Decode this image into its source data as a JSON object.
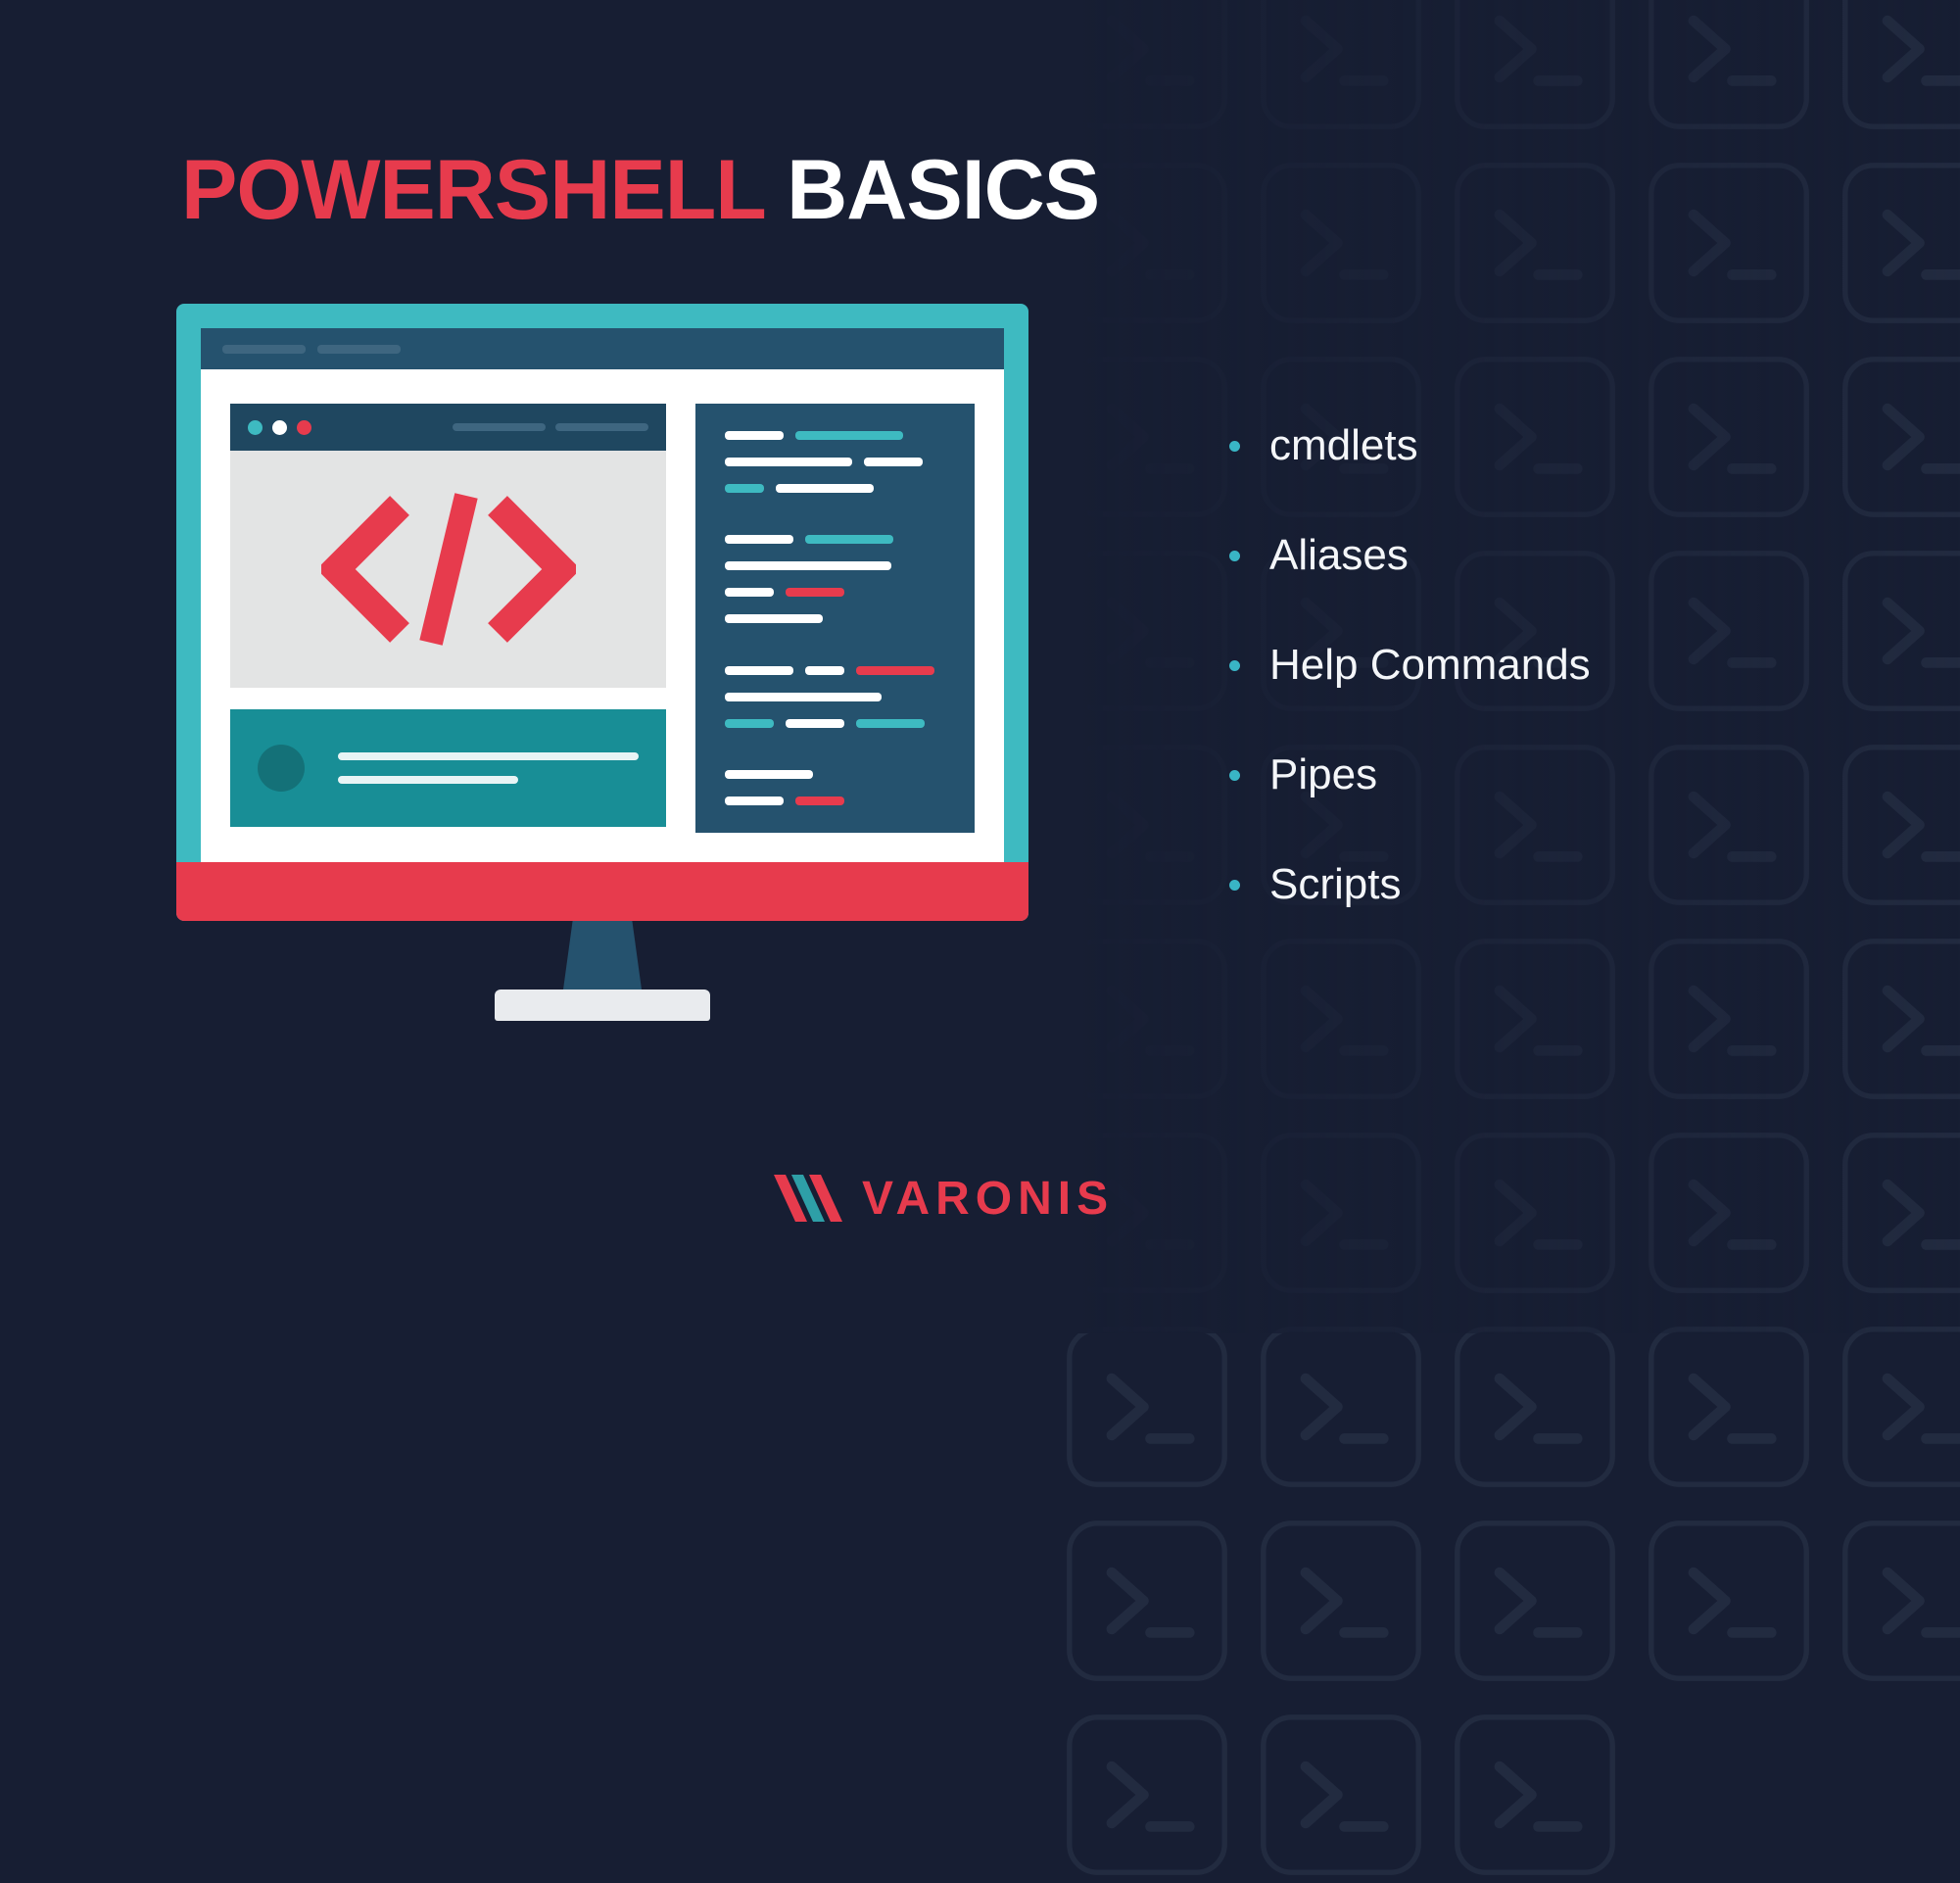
{
  "title": {
    "word1": "POWERSHELL",
    "word2": "BASICS"
  },
  "bullets": {
    "items": [
      {
        "label": "cmdlets"
      },
      {
        "label": "Aliases"
      },
      {
        "label": "Help Commands"
      },
      {
        "label": "Pipes"
      },
      {
        "label": "Scripts"
      }
    ]
  },
  "brand": {
    "name": "VARONIS"
  },
  "colors": {
    "background": "#171E33",
    "accent_red": "#E73B4D",
    "accent_teal": "#3EBAC1",
    "white": "#FFFFFF",
    "panel_dark": "#25526E"
  }
}
